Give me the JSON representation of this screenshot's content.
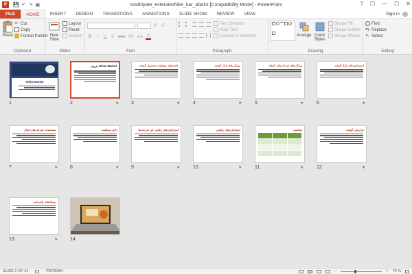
{
  "window": {
    "title": "modiriyate_esteratezhike_kar_afarini [Compatibility Mode] - PowerPoint",
    "app_icon": "P",
    "controls": [
      "?",
      "☐",
      "—",
      "☐",
      "✕"
    ],
    "qat": [
      "save-icon",
      "undo-icon",
      "redo-icon",
      "slideshow-icon"
    ]
  },
  "tabs": [
    "FILE",
    "HOME",
    "INSERT",
    "DESIGN",
    "TRANSITIONS",
    "ANIMATIONS",
    "SLIDE SHOW",
    "REVIEW",
    "VIEW"
  ],
  "active_tab": "HOME",
  "signin": "Sign in",
  "ribbon": {
    "clipboard": {
      "label": "Clipboard",
      "paste": "Paste",
      "cut": "Cut",
      "copy": "Copy",
      "format_painter": "Format Painter"
    },
    "slides": {
      "label": "Slides",
      "new_slide_l1": "New",
      "new_slide_l2": "Slide",
      "layout": "Layout",
      "reset": "Reset",
      "section": "Section"
    },
    "font": {
      "label": "Font",
      "buttons": [
        "B",
        "I",
        "U",
        "S",
        "abc",
        "AV",
        "Aa",
        "A"
      ]
    },
    "paragraph": {
      "label": "Paragraph",
      "text_direction": "Text Direction",
      "align_text": "Align Text",
      "convert": "Convert to SmartArt"
    },
    "drawing": {
      "label": "Drawing",
      "arrange": "Arrange",
      "quick_l1": "Quick",
      "quick_l2": "Styles",
      "shape_fill": "Shape Fill",
      "shape_outline": "Shape Outline",
      "shape_effects": "Shape Effects"
    },
    "editing": {
      "label": "Editing",
      "find": "Find",
      "replace": "Replace",
      "select": "Select"
    }
  },
  "slides": [
    {
      "num": "1",
      "title": "Niche Market"
    },
    {
      "num": "2",
      "title": "Niche Market تعریف"
    },
    {
      "num": "3",
      "title": "عامل‌های موفقیت محصول گوشه"
    },
    {
      "num": "4",
      "title": "ویژگی‌های بازار گوشه"
    },
    {
      "num": "5",
      "title": "ویژگی‌های شرکت‌های کوچک"
    },
    {
      "num": "6",
      "title": "استراتژی‌های بازار گوشه"
    },
    {
      "num": "7",
      "title": "مشخصات شرکت‌های فعال"
    },
    {
      "num": "8",
      "title": "دلایل موفقیت"
    },
    {
      "num": "9",
      "title": "استراتژی‌های رقابتی این شرکت‌ها"
    },
    {
      "num": "10",
      "title": "استراتژی‌های رقابتی"
    },
    {
      "num": "11",
      "title": "مقایسه"
    },
    {
      "num": "12",
      "title": "بازاریابی گوشه"
    },
    {
      "num": "13",
      "title": "ریسک‌های بازاریابی"
    },
    {
      "num": "14",
      "title": ""
    }
  ],
  "status": {
    "slide_of": "SLIDE 2 OF 14",
    "language": "PERSIAN",
    "zoom": "70 %",
    "zoom_level": 0.7
  },
  "colors": {
    "accent": "#d24726",
    "title_red": "#b5371a"
  }
}
